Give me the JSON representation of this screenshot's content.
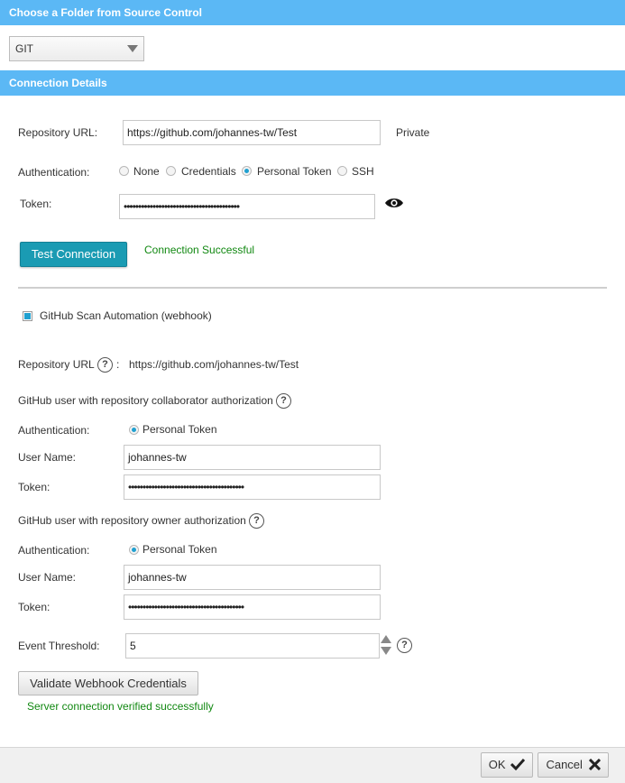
{
  "dialog": {
    "title": "Choose a Folder from Source Control",
    "source_type": "GIT"
  },
  "connection": {
    "header": "Connection Details",
    "repo_url_label": "Repository URL:",
    "repo_url_value": "https://github.com/johannes-tw/Test",
    "visibility": "Private",
    "auth_label": "Authentication:",
    "auth_options": [
      "None",
      "Credentials",
      "Personal Token",
      "SSH"
    ],
    "auth_selected": "Personal Token",
    "token_label": "Token:",
    "token_value": "••••••••••••••••••••••••••••••••••••••••",
    "test_button": "Test Connection",
    "test_status": "Connection Successful"
  },
  "webhook": {
    "checkbox_label": "GitHub Scan Automation (webhook)",
    "checked": true,
    "repo_url_label": "Repository URL",
    "repo_url_sep": ":",
    "repo_url_value": "https://github.com/johannes-tw/Test",
    "collaborator": {
      "section_title": "GitHub user with repository collaborator authorization",
      "auth_label": "Authentication:",
      "auth_option": "Personal Token",
      "username_label": "User Name:",
      "username_value": "johannes-tw",
      "token_label": "Token:",
      "token_value": "••••••••••••••••••••••••••••••••••••••••"
    },
    "owner": {
      "section_title": "GitHub user with repository owner authorization",
      "auth_label": "Authentication:",
      "auth_option": "Personal Token",
      "username_label": "User Name:",
      "username_value": "johannes-tw",
      "token_label": "Token:",
      "token_value": "••••••••••••••••••••••••••••••••••••••••"
    },
    "threshold_label": "Event Threshold:",
    "threshold_value": "5",
    "validate_button": "Validate Webhook Credentials",
    "validate_status": "Server connection verified successfully"
  },
  "footer": {
    "ok_label": "OK",
    "cancel_label": "Cancel"
  },
  "colors": {
    "header_bg": "#5bb8f5",
    "primary_button": "#1a9bb3",
    "success_text": "#118811",
    "radio_selected": "#20a0d0"
  },
  "icons": [
    "eye-icon",
    "help-icon",
    "checkmark-icon",
    "close-icon",
    "dropdown-arrow-icon",
    "spinner-up-icon",
    "spinner-down-icon"
  ]
}
